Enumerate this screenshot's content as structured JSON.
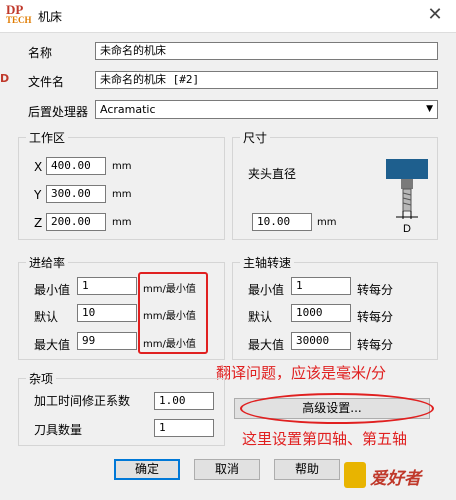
{
  "window": {
    "title": "机床",
    "app_icon_top": "DP",
    "app_icon_bottom": "TECH",
    "close_glyph": "✕"
  },
  "form": {
    "name": {
      "label": "名称",
      "value": "未命名的机床"
    },
    "filename": {
      "label": "文件名",
      "value": "未命名的机床 [#2]"
    },
    "postprocessor": {
      "label": "后置处理器",
      "value": "Acramatic"
    }
  },
  "workspace": {
    "title": "工作区",
    "unit": "mm",
    "x": {
      "label": "X",
      "value": "400.00"
    },
    "y": {
      "label": "Y",
      "value": "300.00"
    },
    "z": {
      "label": "Z",
      "value": "200.00"
    }
  },
  "size": {
    "title": "尺寸",
    "chuck_label": "夹头直径",
    "chuck_value": "10.00",
    "unit": "mm",
    "diagram_label": "D"
  },
  "feedrate": {
    "title": "进给率",
    "min": {
      "label": "最小值",
      "value": "1",
      "unit": "mm/最小值"
    },
    "default": {
      "label": "默认",
      "value": "10",
      "unit": "mm/最小值"
    },
    "max": {
      "label": "最大值",
      "value": "99",
      "unit": "mm/最小值"
    }
  },
  "spindle": {
    "title": "主轴转速",
    "min": {
      "label": "最小值",
      "value": "1",
      "unit": "转每分"
    },
    "default": {
      "label": "默认",
      "value": "1000",
      "unit": "转每分"
    },
    "max": {
      "label": "最大值",
      "value": "30000",
      "unit": "转每分"
    }
  },
  "misc": {
    "title": "杂项",
    "time_corr": {
      "label": "加工时间修正系数",
      "value": "1.00"
    },
    "tool_count": {
      "label": "刀具数量",
      "value": "1"
    }
  },
  "buttons": {
    "advanced": "高级设置...",
    "ok": "确定",
    "cancel": "取消",
    "help": "帮助"
  },
  "annotations": {
    "translation_note": "翻译问题，应该是毫米/分",
    "axis_note": "这里设置第四轴、第五轴"
  },
  "watermark": "爱好者",
  "colors": {
    "annotation_red": "#e02020",
    "default_button_border": "#0078d7",
    "chuck_blue": "#1e5f8e"
  }
}
